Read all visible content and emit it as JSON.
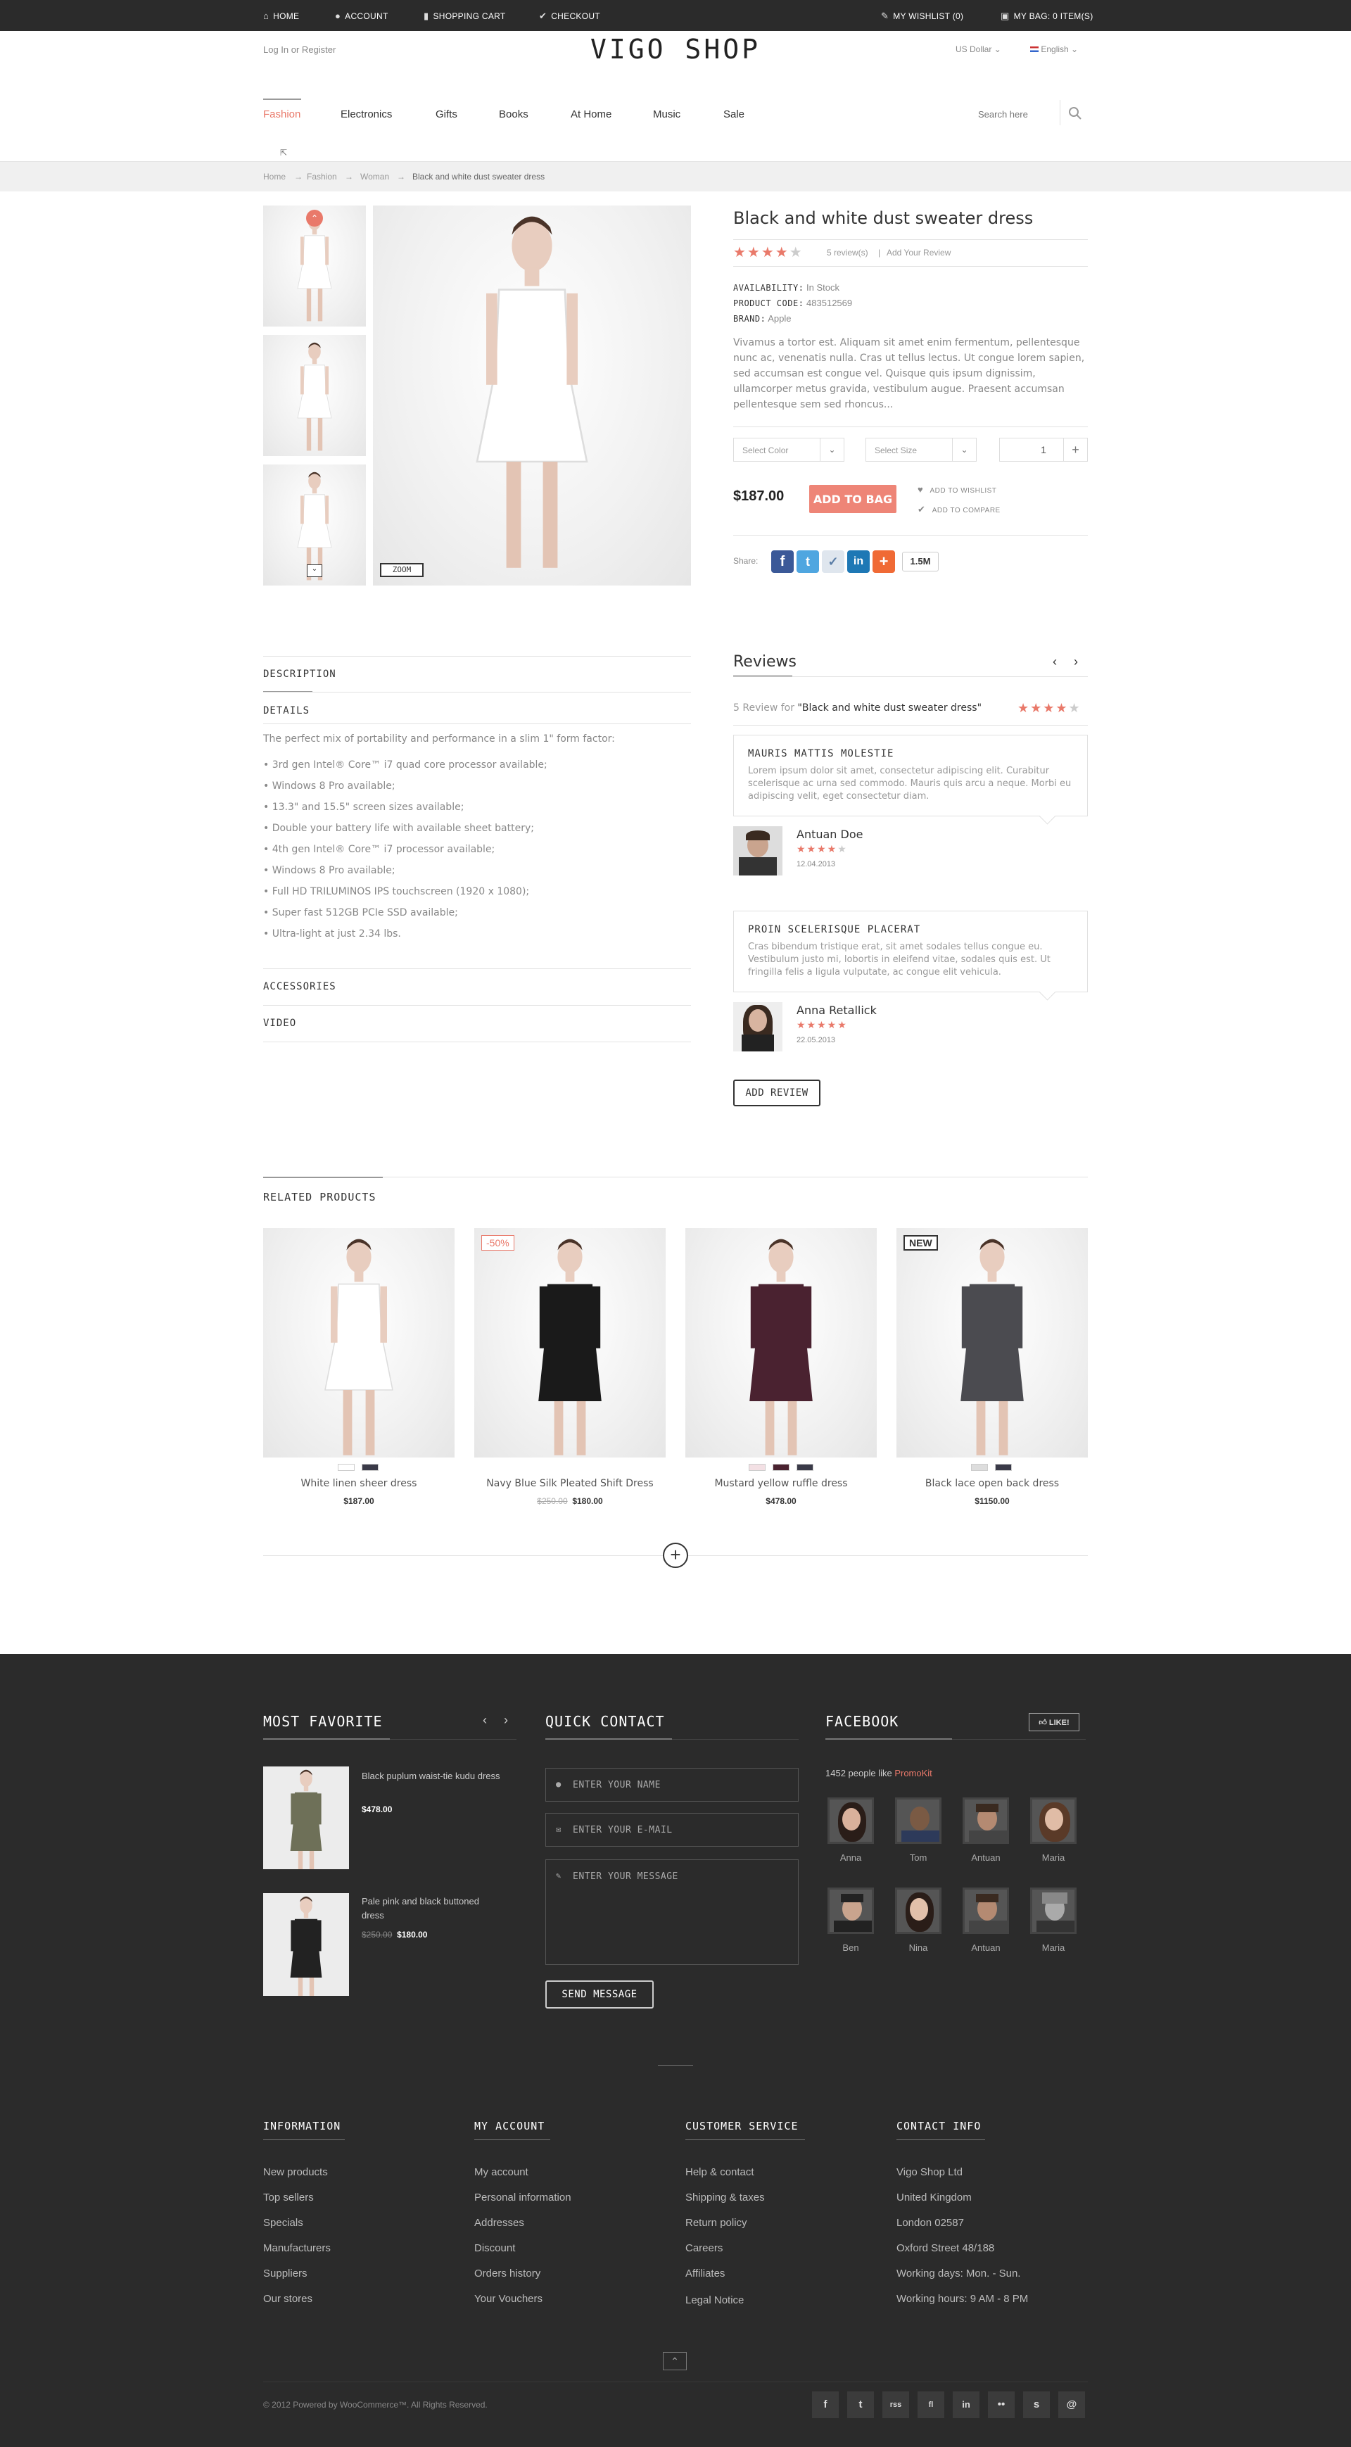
{
  "topbar": {
    "home": "HOME",
    "account": "ACCOUNT",
    "cart": "SHOPPING CART",
    "checkout": "CHECKOUT",
    "wishlist": "MY WISHLIST (0)",
    "bag": "MY BAG: 0 ITEM(S)"
  },
  "header": {
    "login": "Log In or Register",
    "currency": "US Dollar",
    "language": "English",
    "logo": "VIGO SHOP",
    "search_placeholder": "Search here"
  },
  "nav": [
    "Fashion",
    "Electronics",
    "Gifts",
    "Books",
    "At Home",
    "Music",
    "Sale"
  ],
  "breadcrumb": [
    "Home",
    "Fashion",
    "Woman",
    "Black and white dust sweater dress"
  ],
  "product": {
    "title": "Black and white dust sweater dress",
    "rating": 4,
    "reviews_count": "5 review(s)",
    "add_review_link": "Add Your Review",
    "availability_label": "AVAILABILITY:",
    "availability": "In Stock",
    "code_label": "PRODUCT CODE:",
    "code": "483512569",
    "brand_label": "BRAND:",
    "brand": "Apple",
    "description": "Vivamus a tortor est. Aliquam sit amet enim fermentum, pellentesque nunc ac, venenatis nulla. Cras ut tellus lectus. Ut congue lorem sapien, sed accumsan est congue vel. Quisque quis ipsum dignissim, ullamcorper metus gravida, vestibulum augue. Praesent accumsan pellentesque sem sed rhoncus...",
    "select_color": "Select Color",
    "select_size": "Select Size",
    "quantity": "1",
    "price": "$187.00",
    "add_to_bag": "ADD TO BAG",
    "add_to_wishlist": "ADD TO WISHLIST",
    "add_to_compare": "ADD TO COMPARE",
    "share_label": "Share:",
    "share_count": "1.5M",
    "zoom": "ZOOM"
  },
  "tabs": {
    "description": "DESCRIPTION",
    "details": "DETAILS",
    "accessories": "ACCESSORIES",
    "video": "VIDEO",
    "intro": "The perfect mix of portability and performance in a slim 1\" form factor:",
    "bullets": [
      "• 3rd gen Intel® Core™ i7 quad core processor available;",
      "• Windows 8 Pro available;",
      "• 13.3\" and 15.5\" screen sizes available;",
      "• Double your battery life with available sheet battery;",
      "• 4th gen Intel® Core™ i7 processor available;",
      "• Windows 8 Pro available;",
      "• Full HD TRILUMINOS IPS touchscreen (1920 x 1080);",
      "• Super fast 512GB PCIe SSD available;",
      "• Ultra-light at just 2.34 lbs."
    ]
  },
  "reviews": {
    "title": "Reviews",
    "summary_prefix": "5 Review for ",
    "summary_product": "\"Black and white dust sweater dress\"",
    "summary_rating": 4,
    "items": [
      {
        "heading": "MAURIS MATTIS MOLESTIE",
        "text": "Lorem ipsum dolor sit amet, consectetur adipiscing elit. Curabitur scelerisque ac urna sed commodo. Mauris quis arcu a neque. Morbi eu adipiscing velit, eget consectetur diam.",
        "author": "Antuan Doe",
        "rating": 4,
        "date": "12.04.2013"
      },
      {
        "heading": "PROIN SCELERISQUE PLACERAT",
        "text": "Cras bibendum tristique erat, sit amet sodales tellus congue eu. Vestibulum justo mi, lobortis in eleifend vitae, sodales quis est. Ut fringilla felis a ligula vulputate, ac congue elit vehicula.",
        "author": "Anna Retallick",
        "rating": 5,
        "date": "22.05.2013"
      }
    ],
    "add_review": "ADD REVIEW"
  },
  "related": {
    "title": "RELATED PRODUCTS",
    "items": [
      {
        "name": "White linen sheer dress",
        "price": "$187.00",
        "old_price": "",
        "badge": ""
      },
      {
        "name": "Navy Blue Silk Pleated Shift Dress",
        "price": "$180.00",
        "old_price": "$250.00",
        "badge": "-50%"
      },
      {
        "name": "Mustard yellow ruffle dress",
        "price": "$478.00",
        "old_price": "",
        "badge": ""
      },
      {
        "name": "Black lace open back dress",
        "price": "$1150.00",
        "old_price": "",
        "badge": "NEW"
      }
    ]
  },
  "footer": {
    "most_favorite": "MOST FAVORITE",
    "favorites": [
      {
        "name": "Black puplum waist-tie kudu dress",
        "price": "$478.00",
        "old_price": ""
      },
      {
        "name": "Pale pink and black buttoned dress",
        "price": "$180.00",
        "old_price": "$250.00"
      }
    ],
    "quick_contact": "QUICK CONTACT",
    "name_placeholder": "ENTER YOUR NAME",
    "email_placeholder": "ENTER YOUR E-MAIL",
    "message_placeholder": "ENTER YOUR MESSAGE",
    "send": "SEND MESSAGE",
    "facebook": "FACEBOOK",
    "like": "LIKE!",
    "fb_count": "1452 people like",
    "fb_page": "PromoKit",
    "fb_people": [
      "Anna",
      "Tom",
      "Antuan",
      "Maria",
      "Ben",
      "Nina",
      "Antuan",
      "Maria"
    ],
    "information": {
      "title": "INFORMATION",
      "links": [
        "New products",
        "Top sellers",
        "Specials",
        "Manufacturers",
        "Suppliers",
        "Our stores"
      ]
    },
    "my_account": {
      "title": "MY ACCOUNT",
      "links": [
        "My account",
        "Personal information",
        "Addresses",
        "Discount",
        "Orders history",
        "Your Vouchers"
      ]
    },
    "customer_service": {
      "title": "CUSTOMER SERVICE",
      "links": [
        "Help & contact",
        "Shipping & taxes",
        "Return policy",
        "Careers",
        "Affiliates",
        "Legal Notice"
      ]
    },
    "contact_info": {
      "title": "CONTACT INFO",
      "links": [
        "Vigo Shop Ltd",
        "United Kingdom",
        "London 02587",
        "Oxford Street 48/188",
        "Working days: Mon. - Sun.",
        "Working hours: 9 AM - 8 PM"
      ]
    },
    "copyright": "© 2012 Powered by WooCommerce™. All Rights Reserved.",
    "social": [
      "f",
      "t",
      "rss",
      "fl",
      "in",
      "••",
      "s",
      "@"
    ]
  },
  "colors": {
    "accent": "#e9796a",
    "dark": "#2b2b2b"
  }
}
